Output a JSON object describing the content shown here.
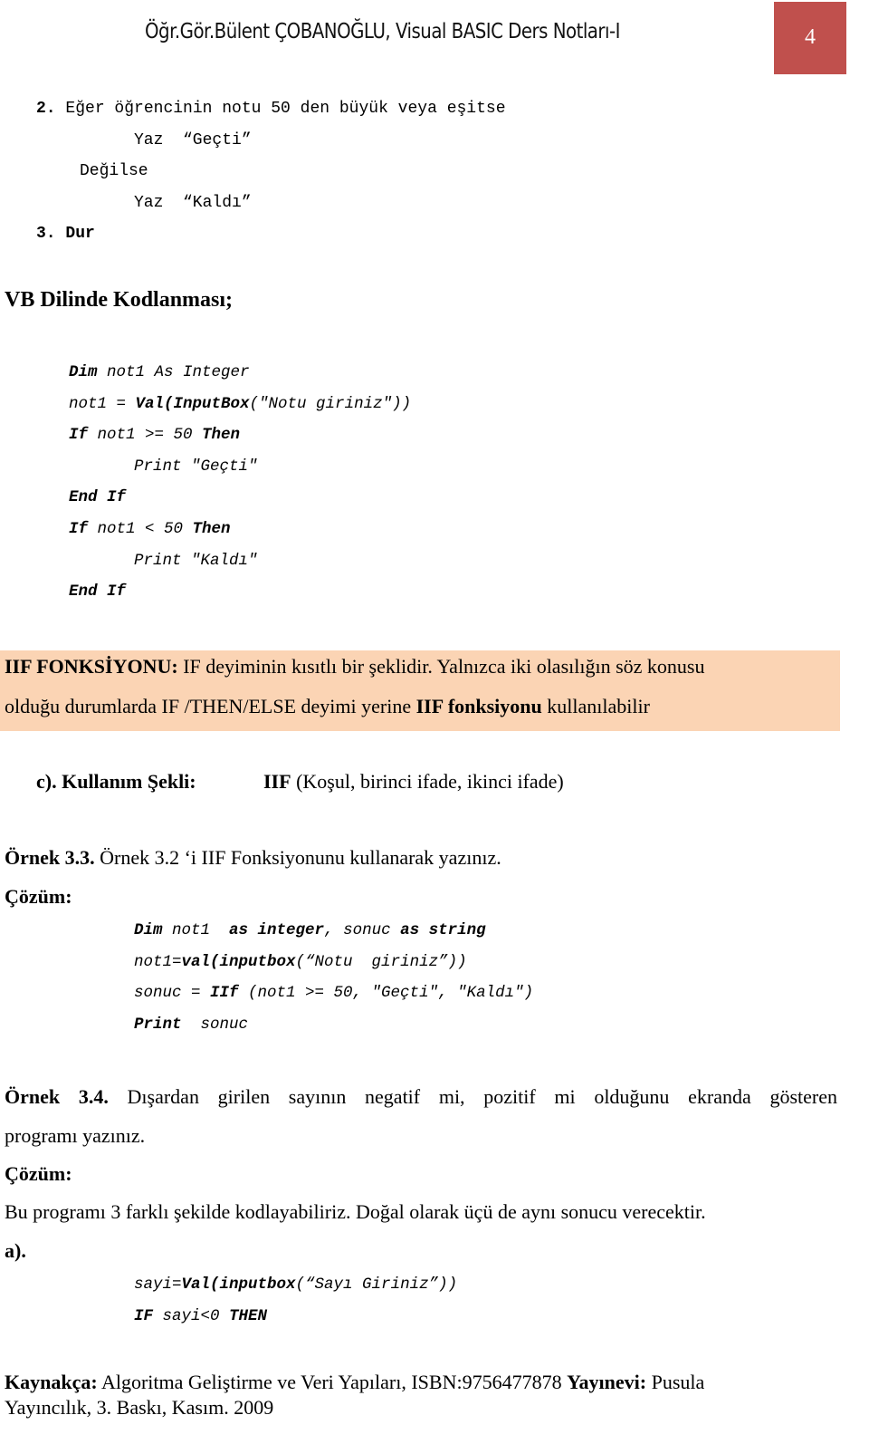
{
  "header": {
    "title": "Öğr.Gör.Bülent ÇOBANOĞLU, Visual BASIC Ders Notları-I",
    "page_number": "4",
    "accent_color": "#c0504d"
  },
  "algorithm": {
    "step2_num": "2.",
    "step2_text": "Eğer öğrencinin notu 50 den büyük veya eşitse",
    "yaz1": "Yaz  “Geçti”",
    "degilse": "Değilse",
    "yaz2": "Yaz  “Kaldı”",
    "step3": "3. Dur"
  },
  "vb_heading": "VB Dilinde Kodlanması;",
  "code1": {
    "l1_kw": "Dim",
    "l1_rest": " not1 As Integer",
    "l2_pre": "not1 = ",
    "l2_kw": "Val(InputBox",
    "l2_rest": "(\"Notu giriniz\"))",
    "l3_kw1": "If",
    "l3_mid": " not1 >= 50 ",
    "l3_kw2": "Then",
    "l4": "Print \"Geçti\"",
    "l5": "End If",
    "l6_kw1": "If",
    "l6_mid": " not1 < 50 ",
    "l6_kw2": "Then",
    "l7": "Print \"Kaldı\"",
    "l8": "End If"
  },
  "iif_box": {
    "bg_color": "#fbd4b4",
    "title": "IIF FONKSİYONU:",
    "line1_rest": " IF deyiminin kısıtlı bir şeklidir. Yalnızca iki olasılığın söz konusu",
    "line2_pre": "olduğu durumlarda IF /THEN/ELSE deyimi yerine ",
    "line2_bold": "IIF fonksiyonu",
    "line2_post": " kullanılabilir"
  },
  "usage": {
    "label": "c). Kullanım Şekli:",
    "syntax_bold": "IIF",
    "syntax_rest": " (Koşul, birinci ifade, ikinci ifade)"
  },
  "example33": {
    "label": "Örnek 3.3.",
    "text": " Örnek 3.2 ‘i IIF Fonksiyonunu kullanarak yazınız.",
    "solution": "Çözüm:",
    "c1_kw": "Dim",
    "c1_a": " not1  ",
    "c1_kw2": "as integer",
    "c1_b": ", sonuc ",
    "c1_kw3": "as string",
    "c2_pre": "not1=",
    "c2_kw": "val(inputbox",
    "c2_rest": "(“Notu  giriniz”))",
    "c3_pre": "sonuc = ",
    "c3_kw": "IIf",
    "c3_rest": " (not1 >= 50, \"Geçti\", \"Kaldı\")",
    "c4_kw": "Print",
    "c4_rest": "  sonuc"
  },
  "example34": {
    "label": "Örnek 3.4.",
    "text": " Dışardan girilen sayının negatif mi, pozitif mi olduğunu ekranda gösteren",
    "text2": "programı yazınız.",
    "solution": "Çözüm:",
    "intro": "Bu programı 3 farklı şekilde kodlayabiliriz. Doğal olarak üçü de aynı sonucu verecektir.",
    "part_a": "a).",
    "c1_pre": "sayi=",
    "c1_kw": "Val(inputbox",
    "c1_rest": "(“Sayı Giriniz”))",
    "c2_kw1": "IF",
    "c2_mid": " sayi<0 ",
    "c2_kw2": "THEN"
  },
  "reference": {
    "label": "Kaynakça:",
    "text": " Algoritma Geliştirme ve Veri Yapıları, ISBN:9756477878 ",
    "publisher_label": "Yayınevi:",
    "publisher": " Pusula",
    "line2": "Yayıncılık, 3. Baskı, Kasım. 2009"
  }
}
